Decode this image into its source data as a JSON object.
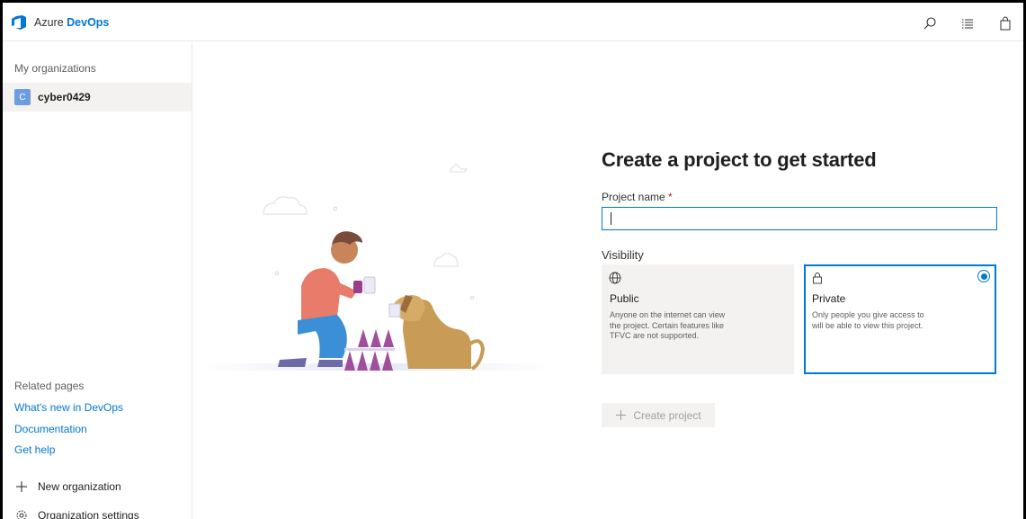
{
  "header": {
    "brand_prefix": "Azure",
    "brand_name": "DevOps",
    "icons": [
      "search-icon",
      "list-icon",
      "shopping-bag-icon"
    ]
  },
  "sidebar": {
    "orgs_heading": "My organizations",
    "organizations": [
      {
        "initial": "C",
        "name": "cyber0429"
      }
    ],
    "related_heading": "Related pages",
    "links": [
      {
        "label": "What's new in DevOps"
      },
      {
        "label": "Documentation"
      },
      {
        "label": "Get help"
      }
    ],
    "actions": [
      {
        "label": "New organization",
        "icon": "plus-icon"
      },
      {
        "label": "Organization settings",
        "icon": "gear-icon"
      }
    ]
  },
  "form": {
    "title": "Create a project to get started",
    "project_name_label": "Project name",
    "required_marker": "*",
    "project_name_value": "",
    "visibility_label": "Visibility",
    "options": {
      "public": {
        "title": "Public",
        "description": "Anyone on the internet can view the project. Certain features like TFVC are not supported.",
        "icon": "globe-icon",
        "selected": false
      },
      "private": {
        "title": "Private",
        "description": "Only people you give access to will be able to view this project.",
        "icon": "lock-icon",
        "selected": true
      }
    },
    "create_button_label": "Create project",
    "create_button_enabled": false
  },
  "colors": {
    "accent": "#0078d4",
    "avatar": "#6e9ce0",
    "required": "#a4262c",
    "card_bg": "#f3f2f1"
  }
}
